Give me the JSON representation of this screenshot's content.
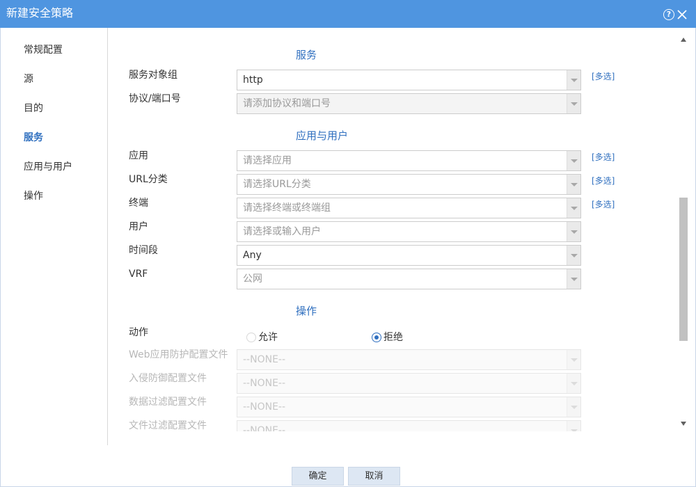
{
  "window": {
    "title": "新建安全策略",
    "help_icon": "help-circle-icon",
    "close_icon": "close-icon"
  },
  "sidebar": {
    "items": [
      {
        "label": "常规配置",
        "active": false
      },
      {
        "label": "源",
        "active": false
      },
      {
        "label": "目的",
        "active": false
      },
      {
        "label": "服务",
        "active": true
      },
      {
        "label": "应用与用户",
        "active": false
      },
      {
        "label": "操作",
        "active": false
      }
    ]
  },
  "sections": {
    "service": {
      "title": "服务",
      "service_group": {
        "label": "服务对象组",
        "value": "http",
        "multi": "[多选]"
      },
      "protocol_port": {
        "label": "协议/端口号",
        "placeholder": "请添加协议和端口号"
      }
    },
    "app_user": {
      "title": "应用与用户",
      "application": {
        "label": "应用",
        "placeholder": "请选择应用",
        "multi": "[多选]"
      },
      "url_category": {
        "label": "URL分类",
        "placeholder": "请选择URL分类",
        "multi": "[多选]"
      },
      "terminal": {
        "label": "终端",
        "placeholder": "请选择终端或终端组",
        "multi": "[多选]"
      },
      "user": {
        "label": "用户",
        "placeholder": "请选择或输入用户"
      },
      "time_range": {
        "label": "时间段",
        "value": "Any"
      },
      "vrf": {
        "label": "VRF",
        "value": "公网"
      }
    },
    "action": {
      "title": "操作",
      "action": {
        "label": "动作",
        "allow": "允许",
        "deny": "拒绝",
        "selected": "deny"
      },
      "waf_profile": {
        "label": "Web应用防护配置文件",
        "value": "--NONE--"
      },
      "ips_profile": {
        "label": "入侵防御配置文件",
        "value": "--NONE--"
      },
      "data_filter_profile": {
        "label": "数据过滤配置文件",
        "value": "--NONE--"
      },
      "file_filter_profile": {
        "label": "文件过滤配置文件",
        "value": "--NONE--"
      }
    }
  },
  "footer": {
    "ok_label": "确定",
    "cancel_label": "取消"
  },
  "colors": {
    "titlebar": "#4f95e0",
    "accent": "#2f6fbf",
    "button_bg": "#dde7f3"
  }
}
